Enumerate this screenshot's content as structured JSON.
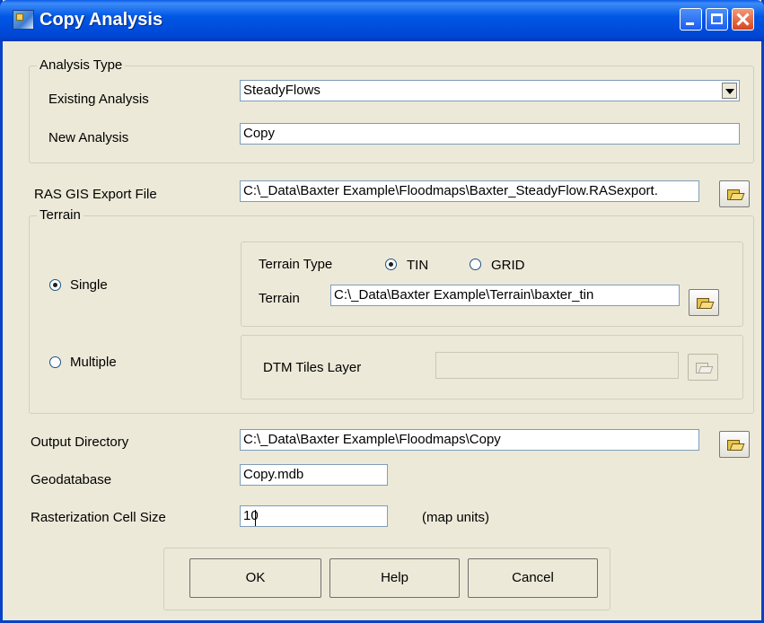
{
  "window": {
    "title": "Copy Analysis"
  },
  "analysis_type": {
    "legend": "Analysis Type",
    "existing_label": "Existing Analysis",
    "existing_value": "SteadyFlows",
    "new_label": "New Analysis",
    "new_value": "Copy"
  },
  "ras_export": {
    "label": "RAS GIS Export File",
    "value": "C:\\_Data\\Baxter Example\\Floodmaps\\Baxter_SteadyFlow.RASexport."
  },
  "terrain": {
    "legend": "Terrain",
    "single_label": "Single",
    "multiple_label": "Multiple",
    "mode": "Single",
    "type_label": "Terrain Type",
    "type_tin_label": "TIN",
    "type_grid_label": "GRID",
    "type_selected": "TIN",
    "terrain_label": "Terrain",
    "terrain_value": "C:\\_Data\\Baxter Example\\Terrain\\baxter_tin",
    "dtm_label": "DTM Tiles Layer",
    "dtm_value": ""
  },
  "output": {
    "dir_label": "Output Directory",
    "dir_value": "C:\\_Data\\Baxter Example\\Floodmaps\\Copy",
    "geodb_label": "Geodatabase",
    "geodb_value": "Copy.mdb",
    "cell_label": "Rasterization Cell Size",
    "cell_value": "10",
    "cell_units": "(map units)"
  },
  "buttons": {
    "ok": "OK",
    "help": "Help",
    "cancel": "Cancel"
  },
  "icons": {
    "app": "grid-map-icon",
    "browse": "open-folder-icon",
    "dropdown": "chevron-down-icon"
  },
  "colors": {
    "titlebar": "#0054e3",
    "dialog_bg": "#ece9d8",
    "field_border": "#7f9db9"
  }
}
